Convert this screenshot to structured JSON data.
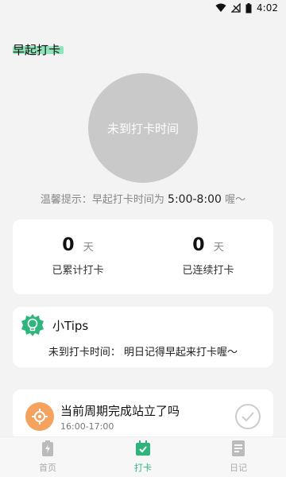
{
  "status_bar": {
    "time": "4:02"
  },
  "page": {
    "title": "早起打卡"
  },
  "checkin": {
    "circle_text": "未到打卡时间"
  },
  "reminder": {
    "prefix": "温馨提示：早起打卡时间为",
    "time": "5:00-8:00",
    "suffix": "喔～"
  },
  "stats": [
    {
      "value": "0",
      "unit": "天",
      "label": "已累计打卡"
    },
    {
      "value": "0",
      "unit": "天",
      "label": "已连续打卡"
    }
  ],
  "tips": {
    "title": "小Tips",
    "body": "未到打卡时间： 明日记得早起来打卡喔～"
  },
  "task": {
    "title": "当前周期完成站立了吗",
    "time": "16:00-17:00"
  },
  "tabs": [
    {
      "label": "首页",
      "icon": "battery-icon",
      "active": false
    },
    {
      "label": "打卡",
      "icon": "calendar-check-icon",
      "active": true
    },
    {
      "label": "日记",
      "icon": "document-icon",
      "active": false
    }
  ],
  "colors": {
    "accent": "#2db57c",
    "highlight": "#7ee0b0",
    "circle": "#c9c9c9",
    "task_icon": "#f4a25e"
  }
}
